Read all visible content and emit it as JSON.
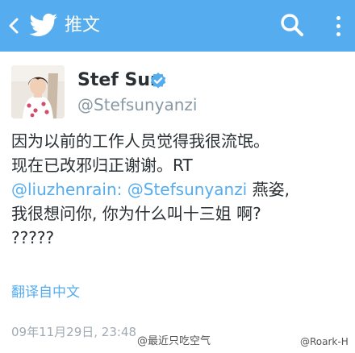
{
  "header": {
    "title": "推文",
    "back_icon": "chevron-left-icon",
    "logo_icon": "twitter-bird-icon",
    "search_icon": "search-icon",
    "more_icon": "overflow-menu-icon",
    "color": "#55acee"
  },
  "author": {
    "name": "Stef Sun",
    "handle": "@Stefsunyanzi",
    "verified": true,
    "verified_icon": "verified-badge-icon"
  },
  "tweet": {
    "line1": "因为以前的工作人员觉得我很流氓。",
    "line2": "现在已改邪归正谢谢。RT",
    "mention1": "@liuzhenrain:",
    "mention2": "@Stefsunyanzi",
    "line3_rest": " 燕姿,",
    "line4": "我很想问你, 你为什么叫十三姐 啊?",
    "line5": "?????"
  },
  "translate_label": "翻译自中文",
  "timestamp": "09年11月29日, 23:48",
  "watermarks": {
    "left": "@最近只吃空气",
    "right": "@Roark-H"
  },
  "colors": {
    "accent": "#55acee",
    "text": "#292f33",
    "muted": "#8899a6"
  }
}
